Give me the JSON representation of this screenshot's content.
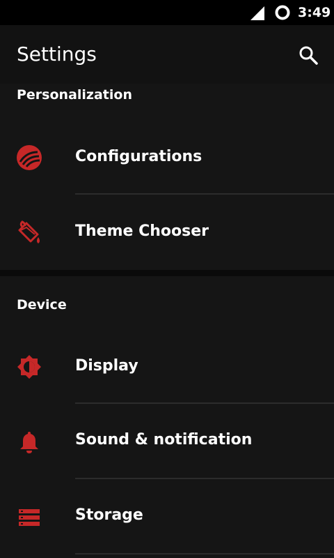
{
  "status_bar": {
    "time": "3:49"
  },
  "app_bar": {
    "title": "Settings"
  },
  "sections": [
    {
      "header": "Personalization",
      "items": [
        {
          "label": "Configurations",
          "icon": "configurations-icon"
        },
        {
          "label": "Theme Chooser",
          "icon": "paint-bucket-icon"
        }
      ]
    },
    {
      "header": "Device",
      "items": [
        {
          "label": "Display",
          "icon": "brightness-icon"
        },
        {
          "label": "Sound & notification",
          "icon": "bell-icon"
        },
        {
          "label": "Storage",
          "icon": "storage-icon"
        }
      ]
    }
  ],
  "colors": {
    "accent": "#c62828",
    "background": "#151515",
    "status_bar": "#000000"
  }
}
